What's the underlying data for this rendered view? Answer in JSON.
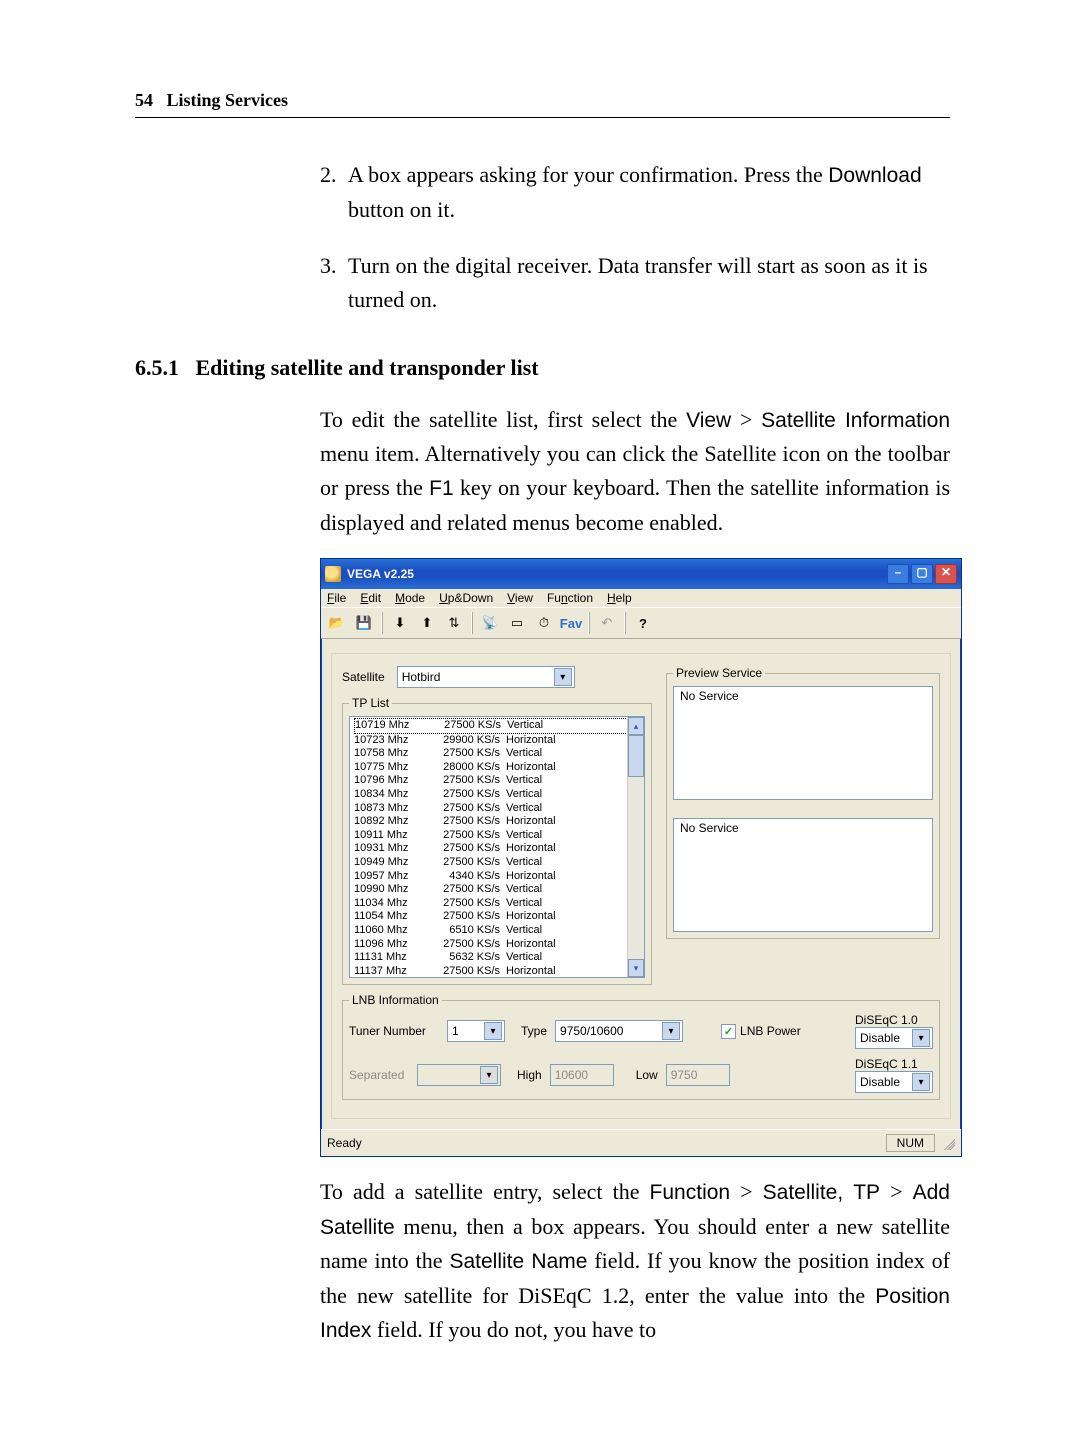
{
  "page": {
    "number": "54",
    "chapter": "Listing Services"
  },
  "step2": {
    "num": "2.",
    "pre": "A box appears asking for your confirmation. Press the ",
    "btn": "Download",
    "post": " button on it."
  },
  "step3": {
    "num": "3.",
    "text": "Turn on the digital receiver. Data transfer will start as soon as it is turned on."
  },
  "heading": {
    "num": "6.5.1",
    "title": "Editing satellite and transponder list"
  },
  "p1": {
    "a": "To edit the satellite list, first select the ",
    "b": "View",
    "c": " > ",
    "d": "Satellite Information",
    "e": " menu item. Alternatively you can click the Satellite icon on the toolbar or press the ",
    "f": "F1",
    "g": " key on your keyboard. Then the satellite information is displayed and related menus become enabled."
  },
  "p2": {
    "a": "To add a satellite entry, select the ",
    "b": "Function",
    "c": " > ",
    "d": "Satellite, TP",
    "e": " > ",
    "f": "Add Satellite",
    "g": " menu, then a box appears. You should enter a new satellite name into the ",
    "h": "Satellite Name",
    "i": " field. If you know the position index of the new satellite for DiSEqC 1.2, enter the value into the ",
    "j": "Position Index",
    "k": " field. If you do not, you have to"
  },
  "win": {
    "title": "VEGA v2.25",
    "menu": {
      "file": "File",
      "edit": "Edit",
      "mode": "Mode",
      "updown": "Up&Down",
      "view": "View",
      "function": "Function",
      "help": "Help"
    },
    "satellite_label": "Satellite",
    "satellite_value": "Hotbird",
    "tplist_label": "TP List",
    "tp_rows": [
      {
        "f": "10719 Mhz",
        "s": "27500 KS/s",
        "p": "Vertical"
      },
      {
        "f": "10723 Mhz",
        "s": "29900 KS/s",
        "p": "Horizontal"
      },
      {
        "f": "10758 Mhz",
        "s": "27500 KS/s",
        "p": "Vertical"
      },
      {
        "f": "10775 Mhz",
        "s": "28000 KS/s",
        "p": "Horizontal"
      },
      {
        "f": "10796 Mhz",
        "s": "27500 KS/s",
        "p": "Vertical"
      },
      {
        "f": "10834 Mhz",
        "s": "27500 KS/s",
        "p": "Vertical"
      },
      {
        "f": "10873 Mhz",
        "s": "27500 KS/s",
        "p": "Vertical"
      },
      {
        "f": "10892 Mhz",
        "s": "27500 KS/s",
        "p": "Horizontal"
      },
      {
        "f": "10911 Mhz",
        "s": "27500 KS/s",
        "p": "Vertical"
      },
      {
        "f": "10931 Mhz",
        "s": "27500 KS/s",
        "p": "Horizontal"
      },
      {
        "f": "10949 Mhz",
        "s": "27500 KS/s",
        "p": "Vertical"
      },
      {
        "f": "10957 Mhz",
        "s": "4340 KS/s",
        "p": "Horizontal"
      },
      {
        "f": "10990 Mhz",
        "s": "27500 KS/s",
        "p": "Vertical"
      },
      {
        "f": "11034 Mhz",
        "s": "27500 KS/s",
        "p": "Vertical"
      },
      {
        "f": "11054 Mhz",
        "s": "27500 KS/s",
        "p": "Horizontal"
      },
      {
        "f": "11060 Mhz",
        "s": "6510 KS/s",
        "p": "Vertical"
      },
      {
        "f": "11096 Mhz",
        "s": "27500 KS/s",
        "p": "Horizontal"
      },
      {
        "f": "11131 Mhz",
        "s": "5632 KS/s",
        "p": "Vertical"
      },
      {
        "f": "11137 Mhz",
        "s": "27500 KS/s",
        "p": "Horizontal"
      }
    ],
    "preview_label": "Preview Service",
    "no_service": "No Service",
    "lnb_label": "LNB Information",
    "tuner_label": "Tuner Number",
    "tuner_value": "1",
    "type_label": "Type",
    "type_value": "9750/10600",
    "lnbpower_label": "LNB Power",
    "diseqc10_label": "DiSEqC 1.0",
    "diseqc10_value": "Disable",
    "separated_label": "Separated",
    "high_label": "High",
    "high_value": "10600",
    "low_label": "Low",
    "low_value": "9750",
    "diseqc11_label": "DiSEqC 1.1",
    "diseqc11_value": "Disable",
    "status_ready": "Ready",
    "status_num": "NUM"
  }
}
